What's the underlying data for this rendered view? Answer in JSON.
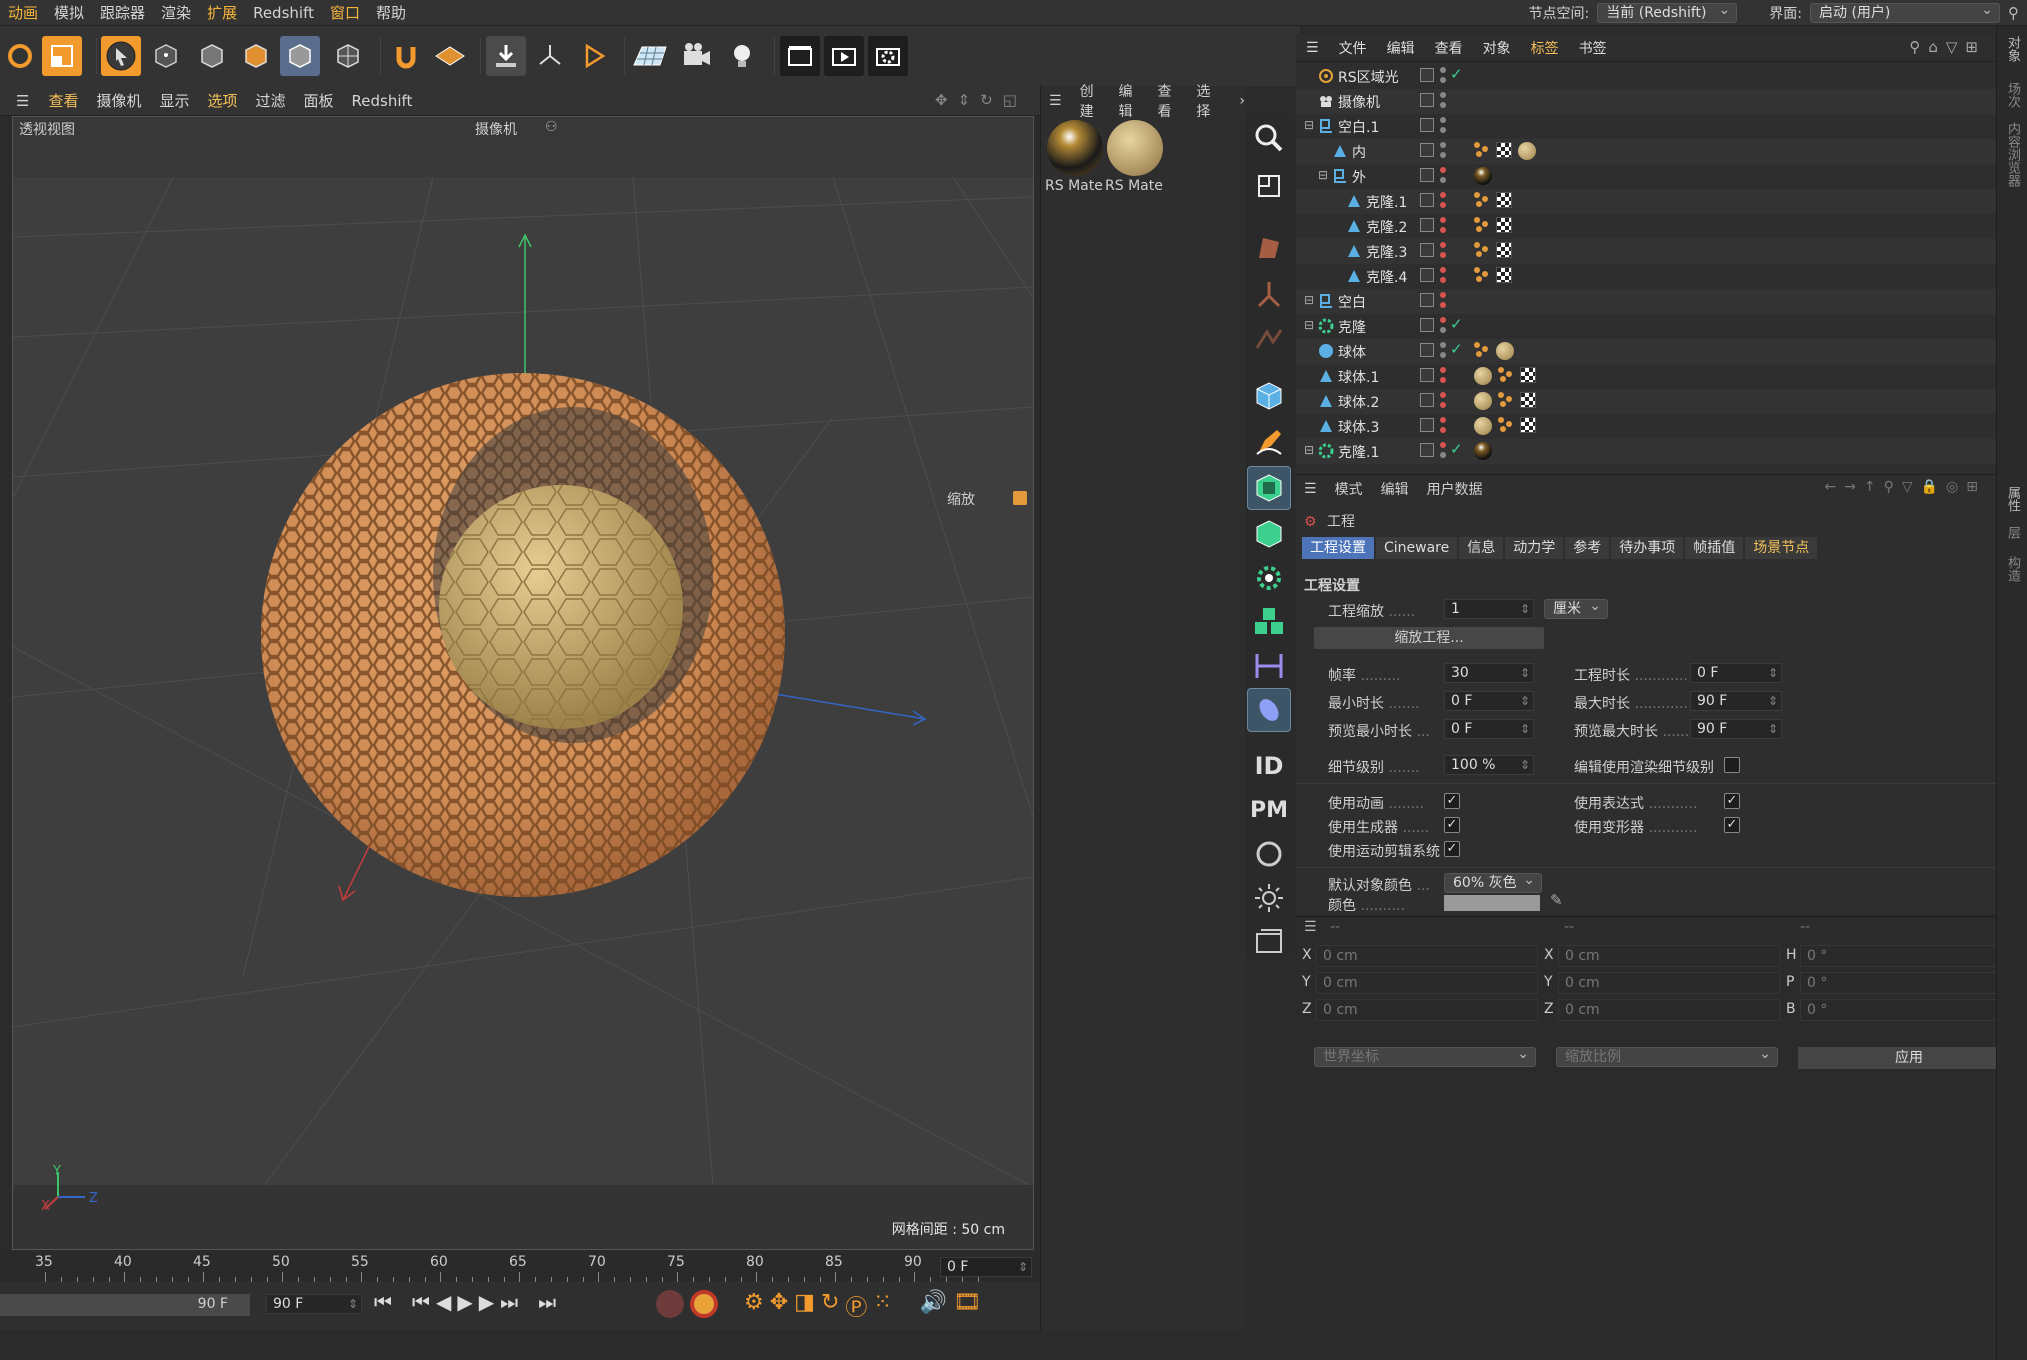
{
  "menubar": {
    "items": [
      "动画",
      "模拟",
      "跟踪器",
      "渲染",
      "扩展",
      "Redshift",
      "窗口",
      "帮助"
    ],
    "highlight": [
      0,
      4,
      6
    ],
    "node_space_label": "节点空间:",
    "node_space_value": "当前 (Redshift)",
    "layout_label": "界面:",
    "layout_value": "启动 (用户)"
  },
  "viewport": {
    "menu": [
      "查看",
      "摄像机",
      "显示",
      "选项",
      "过滤",
      "面板",
      "Redshift"
    ],
    "menu_highlight": [
      0,
      3
    ],
    "title": "透视视图",
    "camera_label": "摄像机",
    "zoom_label": "缩放",
    "grid_spacing": "网格间距 : 50 cm",
    "axis_x": "X",
    "axis_y": "Y",
    "axis_z": "Z"
  },
  "timeline": {
    "ticks": [
      "35",
      "40",
      "45",
      "50",
      "55",
      "60",
      "65",
      "70",
      "75",
      "80",
      "85",
      "90"
    ],
    "current_frame": "0 F"
  },
  "playbar": {
    "end_frame": "90 F",
    "end_frame2": "90 F"
  },
  "materials": {
    "menu": [
      "创建",
      "编辑",
      "查看",
      "选择"
    ],
    "items": [
      {
        "label": "RS Mate",
        "kind": "chrome"
      },
      {
        "label": "RS Mate",
        "kind": "gold"
      }
    ]
  },
  "objmgr": {
    "menu": [
      "文件",
      "编辑",
      "查看",
      "对象",
      "标签",
      "书签"
    ],
    "menu_highlight": [
      4
    ],
    "rows": [
      {
        "name": "RS区域光",
        "indent": 0,
        "icon": "light-icon",
        "tags": []
      },
      {
        "name": "摄像机",
        "indent": 0,
        "icon": "camera-icon",
        "tags": []
      },
      {
        "name": "空白.1",
        "indent": 0,
        "icon": "null-icon",
        "tags": []
      },
      {
        "name": "内",
        "indent": 1,
        "icon": "cone-icon",
        "tags": [
          "dots",
          "grid",
          "ball"
        ]
      },
      {
        "name": "外",
        "indent": 1,
        "icon": "null-icon",
        "tags": [
          "darkball"
        ]
      },
      {
        "name": "克隆.1",
        "indent": 2,
        "icon": "cone-icon",
        "tags": [
          "dots",
          "grid"
        ]
      },
      {
        "name": "克隆.2",
        "indent": 2,
        "icon": "cone-icon",
        "tags": [
          "dots",
          "grid"
        ]
      },
      {
        "name": "克隆.3",
        "indent": 2,
        "icon": "cone-icon",
        "tags": [
          "dots",
          "grid"
        ]
      },
      {
        "name": "克隆.4",
        "indent": 2,
        "icon": "cone-icon",
        "tags": [
          "dots",
          "grid"
        ]
      },
      {
        "name": "空白",
        "indent": 0,
        "icon": "null-icon",
        "tags": []
      },
      {
        "name": "克隆",
        "indent": 0,
        "icon": "cloner-icon",
        "tags": []
      },
      {
        "name": "球体",
        "indent": 0,
        "icon": "sphere-icon",
        "tags": [
          "dots",
          "ball"
        ]
      },
      {
        "name": "球体.1",
        "indent": 0,
        "icon": "cone-icon",
        "tags": [
          "ball",
          "dots",
          "grid"
        ]
      },
      {
        "name": "球体.2",
        "indent": 0,
        "icon": "cone-icon",
        "tags": [
          "ball",
          "dots",
          "grid"
        ]
      },
      {
        "name": "球体.3",
        "indent": 0,
        "icon": "cone-icon",
        "tags": [
          "ball",
          "dots",
          "grid"
        ]
      },
      {
        "name": "克隆.1",
        "indent": 0,
        "icon": "cloner-icon",
        "tags": [
          "darkball"
        ]
      }
    ]
  },
  "attr": {
    "menu": [
      "模式",
      "编辑",
      "用户数据"
    ],
    "object_name": "工程",
    "tabs": [
      "工程设置",
      "Cineware",
      "信息",
      "动力学",
      "参考",
      "待办事项",
      "帧插值",
      "场景节点"
    ],
    "section": "工程设置",
    "project_scale_label": "工程缩放",
    "project_scale_value": "1",
    "project_scale_unit": "厘米",
    "scale_button": "缩放工程...",
    "fps_label": "帧率",
    "fps_value": "30",
    "duration_label": "工程时长",
    "duration_value": "0 F",
    "min_time_label": "最小时长",
    "min_time_value": "0 F",
    "max_time_label": "最大时长",
    "max_time_value": "90 F",
    "prev_min_label": "预览最小时长",
    "prev_min_value": "0 F",
    "prev_max_label": "预览最大时长",
    "prev_max_value": "90 F",
    "lod_label": "细节级别",
    "lod_value": "100 %",
    "render_lod_label": "编辑使用渲染细节级别",
    "use_anim": "使用动画",
    "use_expr": "使用表达式",
    "use_gen": "使用生成器",
    "use_deform": "使用变形器",
    "use_motion": "使用运动剪辑系统",
    "default_color_label": "默认对象颜色",
    "default_color_value": "60% 灰色",
    "color_label": "颜色"
  },
  "coords": {
    "header": [
      "--",
      "--",
      "--"
    ],
    "rows": [
      [
        "X",
        "0 cm",
        "X",
        "0 cm",
        "H",
        "0 °"
      ],
      [
        "Y",
        "0 cm",
        "Y",
        "0 cm",
        "P",
        "0 °"
      ],
      [
        "Z",
        "0 cm",
        "Z",
        "0 cm",
        "B",
        "0 °"
      ]
    ],
    "world": "世界坐标",
    "scale": "缩放比例",
    "apply": "应用"
  },
  "right_tabs": [
    "对象",
    "场次",
    "内容浏览器",
    "属性",
    "层",
    "构造"
  ]
}
